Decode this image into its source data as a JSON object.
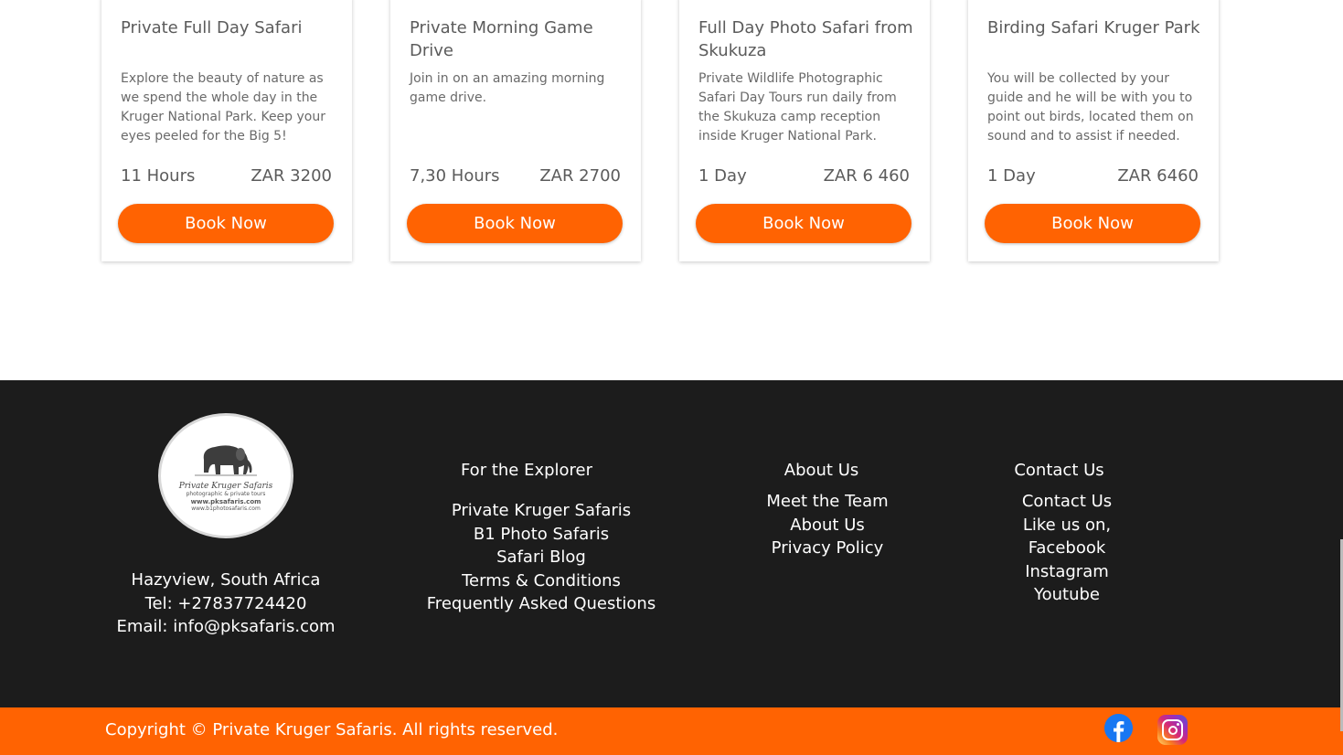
{
  "tours": [
    {
      "title": "Private Full Day Safari",
      "description": "Explore the beauty of nature as we spend the whole day in the Kruger National Park. Keep your eyes peeled for the Big 5!",
      "duration": "11 Hours",
      "price": "ZAR 3200",
      "button": "Book Now"
    },
    {
      "title": "Private Morning Game Drive",
      "description": "Join in on an amazing morning game drive.",
      "duration": "7,30 Hours",
      "price": "ZAR 2700",
      "button": "Book Now"
    },
    {
      "title": "Full Day Photo Safari from Skukuza",
      "description": "Private Wildlife Photographic Safari Day Tours run daily from the Skukuza camp reception inside Kruger National Park.",
      "duration": "1 Day",
      "price": "ZAR 6 460",
      "button": "Book Now"
    },
    {
      "title": "Birding Safari Kruger Park",
      "description": " You will be collected by your guide and he will be with you to point out birds, located them on sound and to assist if needed.",
      "duration": "1 Day",
      "price": "ZAR 6460",
      "button": "Book Now"
    }
  ],
  "footer": {
    "logo": {
      "name": "Private Kruger Safaris",
      "tagline": "photographic & private tours",
      "url1": "www.pksafaris.com",
      "url2": "www.b1photosafaris.com"
    },
    "address": {
      "location": "Hazyview, South Africa",
      "tel": "Tel: +27837724420",
      "email": "Email: info@pksafaris.com"
    },
    "explorer": {
      "heading": "For the Explorer",
      "links": [
        "Private Kruger Safaris",
        "B1 Photo Safaris",
        "Safari Blog",
        "Terms & Conditions",
        "Frequently Asked Questions"
      ]
    },
    "about": {
      "heading": "About Us",
      "links": [
        "Meet the Team",
        "About Us",
        "Privacy Policy"
      ]
    },
    "contact": {
      "heading": "Contact Us",
      "links": [
        "Contact Us",
        "Like us on,",
        "Facebook",
        "Instagram",
        "Youtube"
      ]
    }
  },
  "bottom_bar": {
    "copyright": "Copyright © Private Kruger Safaris. All rights reserved.",
    "social_icons": [
      "facebook-icon",
      "instagram-icon"
    ]
  },
  "colors": {
    "accent": "#ff6302",
    "footer_bg": "#1c1c1c",
    "text": "#5b5b5b"
  }
}
